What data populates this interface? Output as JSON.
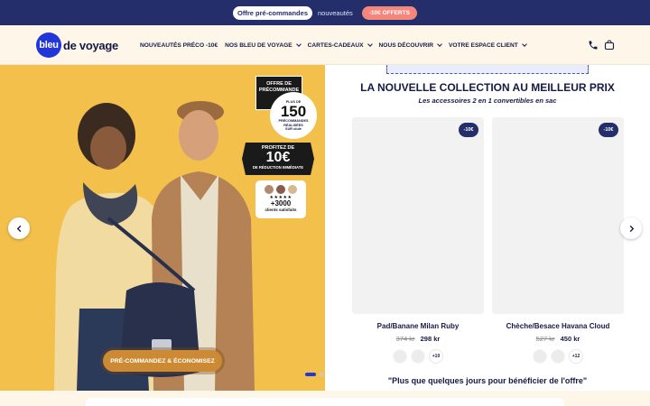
{
  "announcement": {
    "preorder_pill": "Offre pré-commandes",
    "text": "nouveautés",
    "offer_pill": "-10€ OFFERTS"
  },
  "header": {
    "logo_circle": "bleu",
    "logo_text": "de voyage",
    "nav": [
      {
        "label": "NOUVEAUTÉS PRÉCO -10€",
        "has_dropdown": false
      },
      {
        "label": "NOS BLEU DE VOYAGE",
        "has_dropdown": true
      },
      {
        "label": "CARTES-CADEAUX",
        "has_dropdown": true
      },
      {
        "label": "NOUS DÉCOUVRIR",
        "has_dropdown": true
      },
      {
        "label": "VOTRE ESPACE CLIENT",
        "has_dropdown": true
      }
    ],
    "icons": [
      "phone-icon",
      "bag-icon"
    ]
  },
  "hero": {
    "background_color": "#f3c04b",
    "badge_offer": {
      "line1": "OFFRE DE",
      "line2": "PRÉCOMMANDE"
    },
    "badge_150": {
      "top": "PLUS DE",
      "number": "150",
      "middle": "PRÉCOMMANDES RÉALISÉES",
      "bottom": "SUR ulule"
    },
    "badge_10": {
      "top": "PROFITEZ DE",
      "number": "10€",
      "bottom": "DE RÉDUCTION IMMÉDIATE"
    },
    "badge_clients": {
      "stars": "★★★★★",
      "number": "+3000",
      "label": "clients satisfaits"
    },
    "cta_label": "PRÉ-COMMANDEZ & ÉCONOMISEZ",
    "slides_total": 4,
    "slide_active": 1
  },
  "collection": {
    "title": "LA NOUVELLE COLLECTION AU MEILLEUR PRIX",
    "subtitle": "Les accessoires 2 en 1 convertibles en sac",
    "products": [
      {
        "name": "Pad/Banane Milan Ruby",
        "old_price": "374 kr",
        "new_price": "298 kr",
        "discount": "-10€",
        "more_colors": "+10"
      },
      {
        "name": "Chèche/Besace Havana Cloud",
        "old_price": "527 kr",
        "new_price": "450 kr",
        "discount": "-10€",
        "more_colors": "+12"
      }
    ],
    "quote": "\"Plus que quelques jours pour bénéficier de l'offre\""
  },
  "colors": {
    "navy": "#232e6b",
    "brand_blue": "#2236d9",
    "coral": "#f5867b",
    "cream": "#fdf6e9",
    "hero_yellow": "#f3c04b",
    "cta_orange": "#cc8a34"
  }
}
